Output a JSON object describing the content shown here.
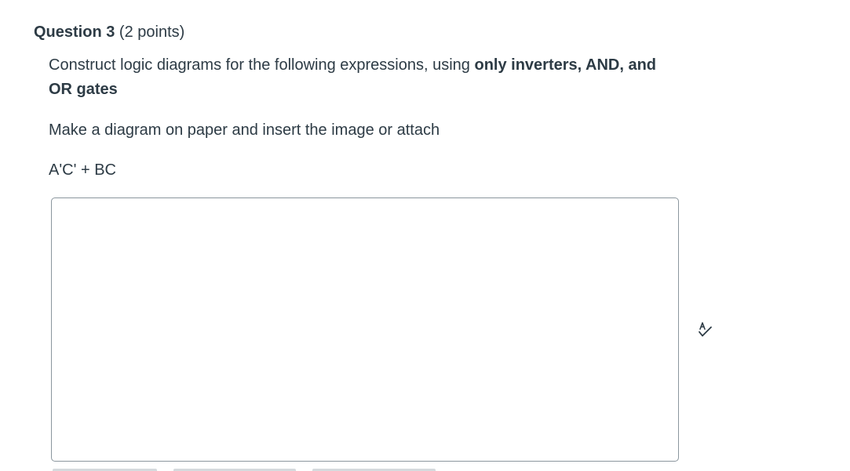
{
  "question": {
    "title": "Question 3",
    "points": "(2 points)",
    "prompt": {
      "text_before": "Construct logic diagrams for the following expressions, using ",
      "bold_text": "only inverters, AND, and OR gates",
      "text_after": ""
    },
    "instructions": "Make a diagram on paper and  insert the image or attach",
    "expression": "A'C' + BC"
  },
  "answer_box": {
    "value": ""
  },
  "icons": {
    "spellcheck": "spellcheck-icon"
  },
  "colors": {
    "text": "#2d3b45",
    "border": "#8b969e",
    "icon": "#2d3b45"
  }
}
